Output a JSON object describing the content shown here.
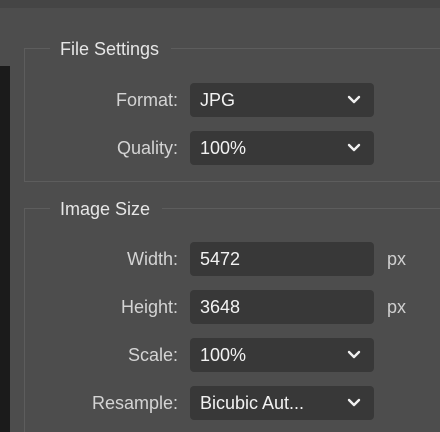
{
  "file_settings": {
    "title": "File Settings",
    "format": {
      "label": "Format:",
      "value": "JPG"
    },
    "quality": {
      "label": "Quality:",
      "value": "100%"
    }
  },
  "image_size": {
    "title": "Image Size",
    "width": {
      "label": "Width:",
      "value": "5472",
      "unit": "px"
    },
    "height": {
      "label": "Height:",
      "value": "3648",
      "unit": "px"
    },
    "scale": {
      "label": "Scale:",
      "value": "100%"
    },
    "resample": {
      "label": "Resample:",
      "value": "Bicubic Aut..."
    }
  },
  "icons": {
    "dropdown": "chevron-down-icon"
  },
  "colors": {
    "panel_bg": "#4d4d4d",
    "field_bg": "#383838",
    "text": "#f2f2f2",
    "label": "#d4d4d4"
  }
}
